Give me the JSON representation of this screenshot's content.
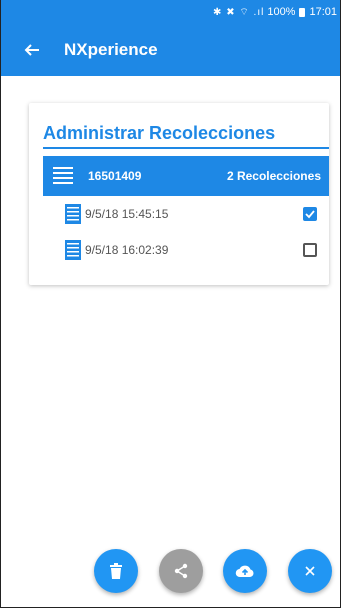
{
  "status_bar": {
    "icons": "✱ ✖ ⌔ .ıl",
    "battery": "100%",
    "time": "17:01"
  },
  "app_bar": {
    "title": "NXperience",
    "back_icon": "arrow-left-icon"
  },
  "card": {
    "title": "Administrar Recolecciones",
    "group": {
      "id": "16501409",
      "count_label": "2 Recolecciones"
    },
    "entries": [
      {
        "date": "9/5/18 15:45:15",
        "checked": true
      },
      {
        "date": "9/5/18 16:02:39",
        "checked": false
      }
    ]
  },
  "actions": [
    {
      "name": "delete",
      "icon": "trash-icon",
      "color": "#2196f3"
    },
    {
      "name": "share",
      "icon": "share-icon",
      "color": "#9e9e9e"
    },
    {
      "name": "upload",
      "icon": "cloud-upload-icon",
      "color": "#2196f3"
    },
    {
      "name": "close",
      "icon": "close-icon",
      "color": "#2196f3"
    }
  ],
  "colors": {
    "primary": "#1e88e5",
    "fab_blue": "#2196f3",
    "fab_disabled": "#9e9e9e"
  }
}
